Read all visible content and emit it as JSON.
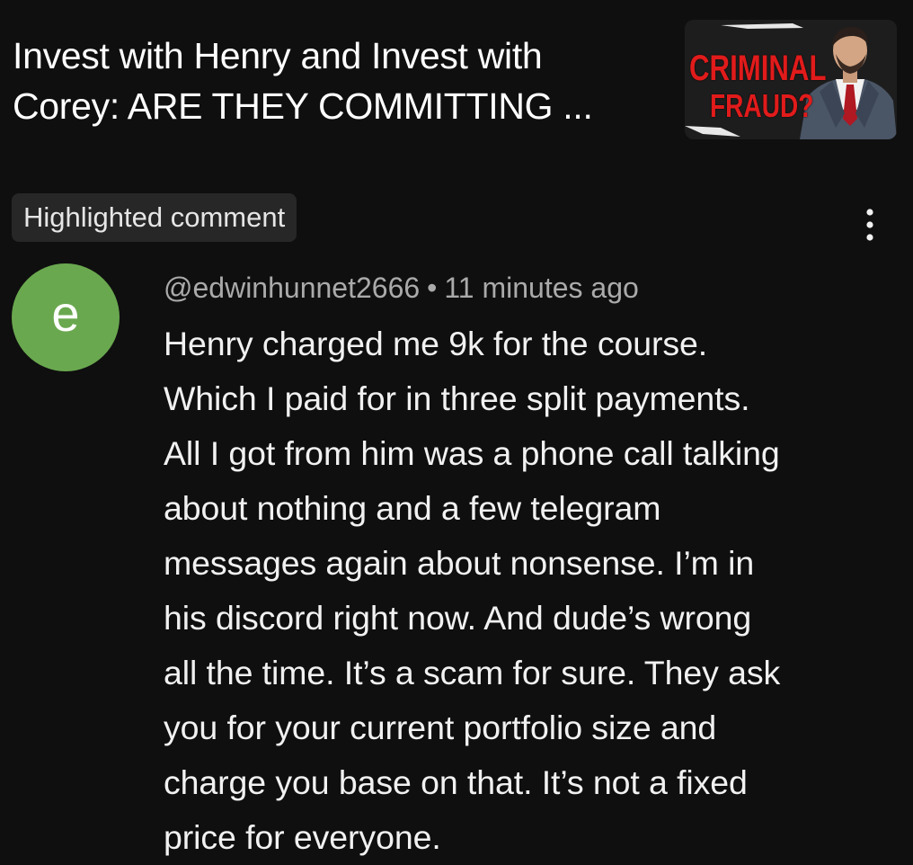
{
  "video": {
    "title_line1": "Invest with Henry and Invest with",
    "title_line2": "Corey: ARE THEY COMMITTING ...",
    "thumbnail": {
      "text_line1": "CRIMINAL",
      "text_line2": "FRAUD?",
      "accent_color": "#e11b1b"
    }
  },
  "comment": {
    "badge": "Highlighted comment",
    "avatar_letter": "e",
    "avatar_color": "#6aa84f",
    "author": "@edwinhunnet2666",
    "separator": "•",
    "time": "11 minutes ago",
    "body_lines": [
      "Henry charged me 9k for the course.",
      "Which I paid for in three split payments.",
      "All I got from him was a phone call talking",
      "about nothing and a few telegram",
      "messages again about nonsense. I’m in",
      "his discord right now. And dude’s wrong",
      "all the time. It’s a scam for sure. They ask",
      "you for your current portfolio size and",
      "charge you base on that. It’s not a fixed",
      "price for everyone."
    ],
    "menu_icon": "more-vert-icon"
  }
}
